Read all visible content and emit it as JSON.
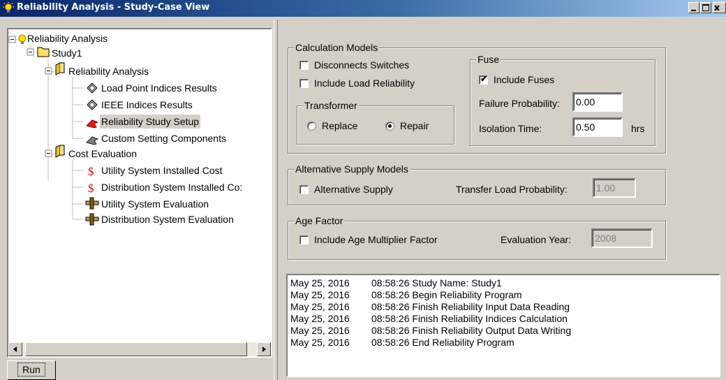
{
  "window": {
    "title": "Reliability Analysis - Study-Case View"
  },
  "tree": {
    "root": "Reliability Analysis",
    "study": "Study1",
    "reliability_folder": "Reliability Analysis",
    "reliability_items": [
      "Load Point Indices Results",
      "IEEE Indices Results",
      "Reliability Study Setup",
      "Custom Setting Components"
    ],
    "cost_folder": "Cost Evaluation",
    "cost_items": [
      "Utility System Installed Cost",
      "Distribution System Installed Co:",
      "Utility System Evaluation",
      "Distribution System Evaluation"
    ],
    "selected": "Reliability Study Setup"
  },
  "run_label": "Run",
  "calc_models": {
    "title": "Calculation Models",
    "disconnects_label": "Disconnects Switches",
    "disconnects_checked": false,
    "load_rel_label": "Include Load Reliability",
    "load_rel_checked": false,
    "transformer": {
      "title": "Transformer",
      "replace_label": "Replace",
      "repair_label": "Repair",
      "selected": "Repair"
    },
    "fuse": {
      "title": "Fuse",
      "include_label": "Include Fuses",
      "include_checked": true,
      "failure_label": "Failure Probability:",
      "failure_value": "0.00",
      "isolation_label": "Isolation Time:",
      "isolation_value": "0.50",
      "isolation_unit": "hrs"
    }
  },
  "alt_supply": {
    "title": "Alternative Supply Models",
    "alt_label": "Alternative Supply",
    "alt_checked": false,
    "transfer_label": "Transfer Load Probability:",
    "transfer_value": "1.00"
  },
  "age_factor": {
    "title": "Age Factor",
    "include_label": "Include Age Multiplier Factor",
    "include_checked": false,
    "year_label": "Evaluation Year:",
    "year_value": "2008"
  },
  "log": [
    {
      "date": "May 25, 2016",
      "msg": "08:58:26 Study Name: Study1"
    },
    {
      "date": "May 25, 2016",
      "msg": "08:58:26 Begin Reliability Program"
    },
    {
      "date": "May 25, 2016",
      "msg": "08:58:26 Finish Reliability Input Data Reading"
    },
    {
      "date": "May 25, 2016",
      "msg": "08:58:26 Finish Reliability Indices Calculation"
    },
    {
      "date": "May 25, 2016",
      "msg": "08:58:26 Finish Reliability Output Data Writing"
    },
    {
      "date": "May 25, 2016",
      "msg": "08:58:26 End Reliability Program"
    }
  ],
  "icons": {
    "app": "lightbulb-icon",
    "folder": "folder-icon",
    "book": "book-icon",
    "results": "diamond-results-icon",
    "setup": "setup-arrow-icon",
    "cost": "dollar-icon",
    "evaluation": "ruler-icon"
  }
}
